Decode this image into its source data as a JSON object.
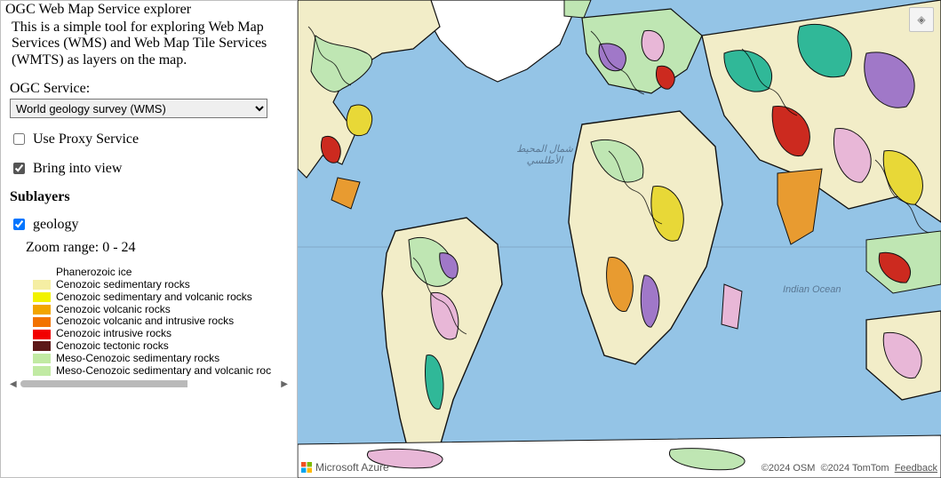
{
  "sidebar": {
    "title": "OGC Web Map Service explorer",
    "desc": "This is a simple tool for exploring Web Map Services (WMS) and Web Map Tile Services (WMTS) as layers on the map.",
    "service_label": "OGC Service:",
    "service_selected": "World geology survey (WMS)",
    "use_proxy_label": "Use Proxy Service",
    "use_proxy_checked": false,
    "bring_into_view_label": "Bring into view",
    "bring_into_view_checked": true,
    "sublayers_heading": "Sublayers",
    "layer": {
      "name": "geology",
      "checked": true,
      "zoom_range": "Zoom range: 0 - 24"
    },
    "legend": [
      {
        "label": "Phanerozoic ice",
        "color": "rgba(0,0,0,0)"
      },
      {
        "label": "Cenozoic sedimentary rocks",
        "color": "#f5eea3"
      },
      {
        "label": "Cenozoic sedimentary and volcanic rocks",
        "color": "#f2f200"
      },
      {
        "label": "Cenozoic volcanic rocks",
        "color": "#f2a500"
      },
      {
        "label": "Cenozoic volcanic and intrusive rocks",
        "color": "#f27200"
      },
      {
        "label": "Cenozoic intrusive rocks",
        "color": "#f20000"
      },
      {
        "label": "Cenozoic tectonic rocks",
        "color": "#5c1818"
      },
      {
        "label": "Meso-Cenozoic sedimentary rocks",
        "color": "#c1eaa3"
      },
      {
        "label": "Meso-Cenozoic sedimentary and volcanic roc",
        "color": "#c1eaa3"
      }
    ]
  },
  "map": {
    "label_north_atlantic": "شمال المحيط\nالأطلسي",
    "label_indian_ocean": "Indian Ocean",
    "control_icon": "◈",
    "attribution_left": "Microsoft Azure",
    "attribution_osm": "©2024 OSM",
    "attribution_tomtom": "©2024 TomTom",
    "feedback": "Feedback"
  },
  "colors": {
    "ocean": "#94c4e6",
    "land_pale": "#f2edc8",
    "land_green": "#bfe6b3",
    "land_pink": "#e8b7d7",
    "land_purple": "#a078c8",
    "land_teal": "#30b898",
    "land_yellow": "#e8d837",
    "land_orange": "#e89b30",
    "land_red": "#cc2a1f",
    "land_dark": "#261313"
  }
}
